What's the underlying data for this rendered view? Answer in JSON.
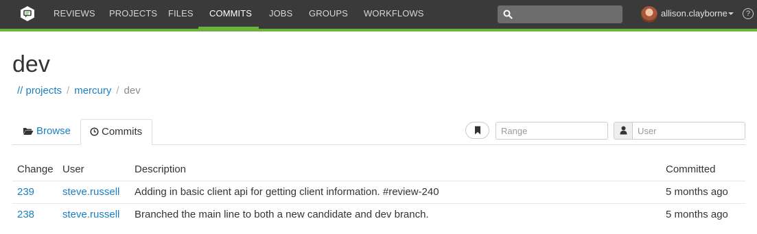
{
  "nav": {
    "items": [
      {
        "label": "REVIEWS",
        "active": false
      },
      {
        "label": "PROJECTS",
        "active": false
      },
      {
        "label": "FILES",
        "active": false
      },
      {
        "label": "COMMITS",
        "active": true
      },
      {
        "label": "JOBS",
        "active": false
      },
      {
        "label": "GROUPS",
        "active": false
      },
      {
        "label": "WORKFLOWS",
        "active": false
      }
    ],
    "search_value": "",
    "user": "allison.clayborne",
    "help_label": "?"
  },
  "page": {
    "title": "dev",
    "breadcrumb": {
      "root": "// projects",
      "sep": "/",
      "project": "mercury",
      "current": "dev"
    }
  },
  "tabs": {
    "browse": "Browse",
    "commits": "Commits",
    "active": "commits"
  },
  "filters": {
    "range_placeholder": "Range",
    "user_placeholder": "User"
  },
  "table": {
    "headers": {
      "change": "Change",
      "user": "User",
      "description": "Description",
      "committed": "Committed"
    },
    "rows": [
      {
        "change": "239",
        "user": "steve.russell",
        "description": "Adding in basic client api for getting client information. #review-240",
        "committed": "5 months ago"
      },
      {
        "change": "238",
        "user": "steve.russell",
        "description": "Branched the main line to both a new candidate and dev branch.",
        "committed": "5 months ago"
      }
    ]
  },
  "colors": {
    "nav_bg": "#3a3a3a",
    "accent": "#6cb33e",
    "link": "#1a7fc1"
  }
}
